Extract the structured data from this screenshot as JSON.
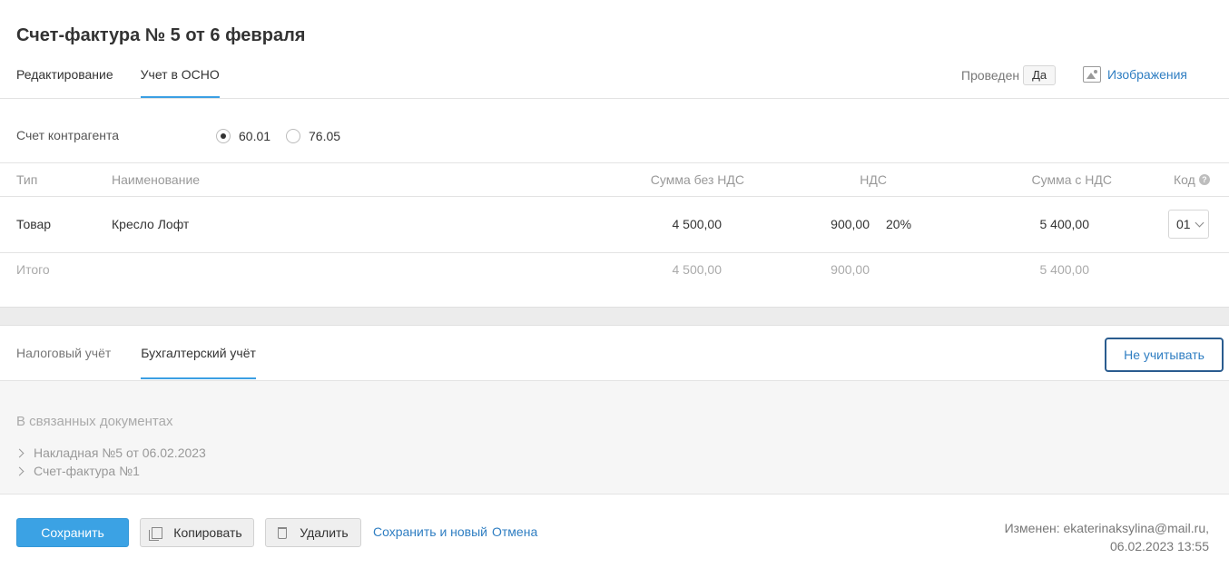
{
  "title": "Счет-фактура № 5 от 6 февраля",
  "top_tabs": [
    {
      "label": "Редактирование",
      "active": false
    },
    {
      "label": "Учет в ОСНО",
      "active": true
    }
  ],
  "posted": {
    "label": "Проведен",
    "value": "Да"
  },
  "images_link": "Изображения",
  "counterparty_account": {
    "label": "Счет контрагента",
    "options": [
      {
        "label": "60.01",
        "selected": true
      },
      {
        "label": "76.05",
        "selected": false
      }
    ]
  },
  "table": {
    "headers": {
      "type": "Тип",
      "name": "Наименование",
      "sum_no_vat": "Сумма без НДС",
      "vat": "НДС",
      "sum_with_vat": "Сумма с НДС",
      "code": "Код"
    },
    "rows": [
      {
        "type": "Товар",
        "name": "Кресло Лофт",
        "sum_no_vat": "4 500,00",
        "vat": "900,00",
        "vat_rate": "20%",
        "sum_with_vat": "5 400,00",
        "code": "01"
      }
    ],
    "total": {
      "label": "Итого",
      "sum_no_vat": "4 500,00",
      "vat": "900,00",
      "sum_with_vat": "5 400,00"
    }
  },
  "bottom_tabs": [
    {
      "label": "Налоговый учёт",
      "active": false
    },
    {
      "label": "Бухгалтерский учёт",
      "active": true
    }
  ],
  "no_account_button": "Не учитывать",
  "related": {
    "title": "В связанных документах",
    "items": [
      "Накладная №5 от 06.02.2023",
      "Счет-фактура №1"
    ]
  },
  "footer": {
    "save": "Сохранить",
    "copy": "Копировать",
    "delete": "Удалить",
    "save_new": "Сохранить и новый",
    "cancel": "Отмена",
    "changed_line1": "Изменен: ekaterinaksylina@mail.ru,",
    "changed_line2": "06.02.2023 13:55"
  },
  "colors": {
    "accent": "#3ba2e4",
    "link": "#2f7ec2"
  }
}
